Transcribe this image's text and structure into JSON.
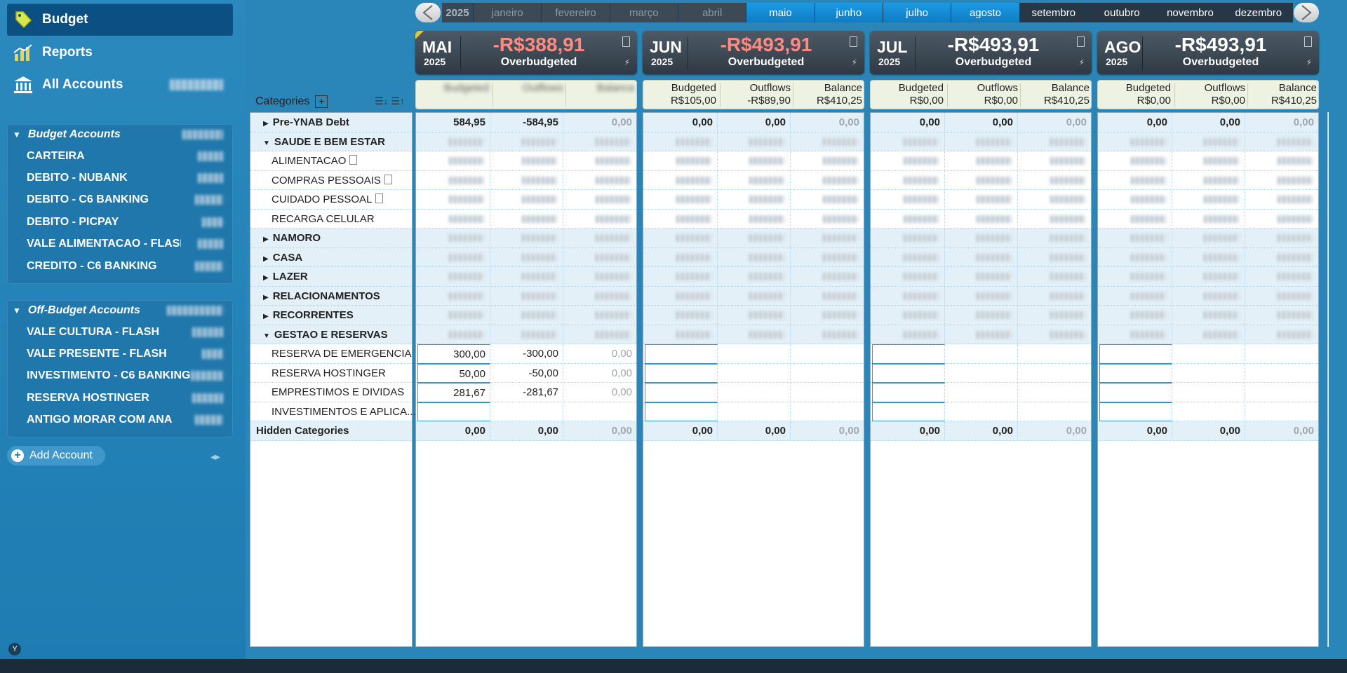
{
  "nav": {
    "budget": "Budget",
    "reports": "Reports",
    "all_accounts": "All Accounts"
  },
  "budget_accounts": {
    "title": "Budget Accounts",
    "items": [
      "CARTEIRA",
      "DEBITO - NUBANK",
      "DEBITO - C6 BANKING",
      "DEBITO - PICPAY",
      "VALE ALIMENTACAO - FLASH",
      "CREDITO - C6 BANKING"
    ]
  },
  "off_budget_accounts": {
    "title": "Off-Budget Accounts",
    "items": [
      "VALE CULTURA - FLASH",
      "VALE PRESENTE - FLASH",
      "INVESTIMENTO - C6 BANKING",
      "RESERVA HOSTINGER",
      "ANTIGO MORAR COM ANA"
    ]
  },
  "add_account": "Add Account",
  "colors": {
    "accent": "#1b9ae4",
    "sidebar": "#2a86b8",
    "negative": "#ff8a80"
  },
  "months_strip": {
    "year": "2025",
    "months": [
      "janeiro",
      "fevereiro",
      "março",
      "abril",
      "maio",
      "junho",
      "julho",
      "agosto",
      "setembro",
      "outubro",
      "novembro",
      "dezembro"
    ]
  },
  "month_headers": [
    {
      "mon": "MAI",
      "year": "2025",
      "total": "-R$388,91",
      "status": "Overbudgeted",
      "negative": true
    },
    {
      "mon": "JUN",
      "year": "2025",
      "total": "-R$493,91",
      "status": "Overbudgeted",
      "negative": true
    },
    {
      "mon": "JUL",
      "year": "2025",
      "total": "-R$493,91",
      "status": "Overbudgeted",
      "negative": false
    },
    {
      "mon": "AGO",
      "year": "2025",
      "total": "-R$493,91",
      "status": "Overbudgeted",
      "negative": false
    }
  ],
  "columns": {
    "budgeted": "Budgeted",
    "outflows": "Outflows",
    "balance": "Balance"
  },
  "column_totals": [
    {
      "budgeted": "",
      "outflows": "",
      "balance": ""
    },
    {
      "budgeted": "R$105,00",
      "outflows": "-R$89,90",
      "balance": "R$410,25"
    },
    {
      "budgeted": "R$0,00",
      "outflows": "R$0,00",
      "balance": "R$410,25"
    },
    {
      "budgeted": "R$0,00",
      "outflows": "R$0,00",
      "balance": "R$410,25"
    }
  ],
  "categories_label": "Categories",
  "rows": [
    {
      "name": "Pre-YNAB Debt",
      "type": "grp",
      "tri": "right",
      "vals": [
        [
          "584,95",
          "-584,95",
          "0,00"
        ],
        [
          "0,00",
          "0,00",
          "0,00"
        ],
        [
          "0,00",
          "0,00",
          "0,00"
        ],
        [
          "0,00",
          "0,00",
          "0,00"
        ]
      ]
    },
    {
      "name": "SAUDE E BEM ESTAR",
      "type": "grp",
      "tri": "down",
      "vals": null
    },
    {
      "name": "ALIMENTACAO",
      "type": "sub",
      "note": true,
      "vals": null
    },
    {
      "name": "COMPRAS PESSOAIS",
      "type": "sub",
      "note": true,
      "vals": null
    },
    {
      "name": "CUIDADO PESSOAL",
      "type": "sub",
      "note": true,
      "vals": null
    },
    {
      "name": "RECARGA CELULAR",
      "type": "sub",
      "vals": null
    },
    {
      "name": "NAMORO",
      "type": "grp",
      "tri": "right",
      "vals": null
    },
    {
      "name": "CASA",
      "type": "grp",
      "tri": "right",
      "vals": null
    },
    {
      "name": "LAZER",
      "type": "grp",
      "tri": "right",
      "vals": null
    },
    {
      "name": "RELACIONAMENTOS",
      "type": "grp",
      "tri": "right",
      "vals": null
    },
    {
      "name": "RECORRENTES",
      "type": "grp",
      "tri": "right",
      "vals": null
    },
    {
      "name": "GESTAO E RESERVAS",
      "type": "grp",
      "tri": "down",
      "vals": null
    },
    {
      "name": "RESERVA DE EMERGENCIA",
      "type": "sub",
      "vals": [
        [
          "300,00",
          "-300,00",
          "0,00"
        ],
        [
          "",
          "",
          ""
        ],
        [
          "",
          "",
          ""
        ],
        [
          "",
          "",
          ""
        ]
      ]
    },
    {
      "name": "RESERVA HOSTINGER",
      "type": "sub",
      "vals": [
        [
          "50,00",
          "-50,00",
          "0,00"
        ],
        [
          "",
          "",
          ""
        ],
        [
          "",
          "",
          ""
        ],
        [
          "",
          "",
          ""
        ]
      ]
    },
    {
      "name": "EMPRESTIMOS E DIVIDAS",
      "type": "sub",
      "vals": [
        [
          "281,67",
          "-281,67",
          "0,00"
        ],
        [
          "",
          "",
          ""
        ],
        [
          "",
          "",
          ""
        ],
        [
          "",
          "",
          ""
        ]
      ]
    },
    {
      "name": "INVESTIMENTOS E APLICA...",
      "type": "sub",
      "vals": [
        [
          "",
          "",
          ""
        ],
        [
          "",
          "",
          ""
        ],
        [
          "",
          "",
          ""
        ],
        [
          "",
          "",
          ""
        ]
      ]
    },
    {
      "name": "Hidden Categories",
      "type": "hidden",
      "vals": [
        [
          "0,00",
          "0,00",
          "0,00"
        ],
        [
          "0,00",
          "0,00",
          "0,00"
        ],
        [
          "0,00",
          "0,00",
          "0,00"
        ],
        [
          "0,00",
          "0,00",
          "0,00"
        ]
      ]
    }
  ]
}
